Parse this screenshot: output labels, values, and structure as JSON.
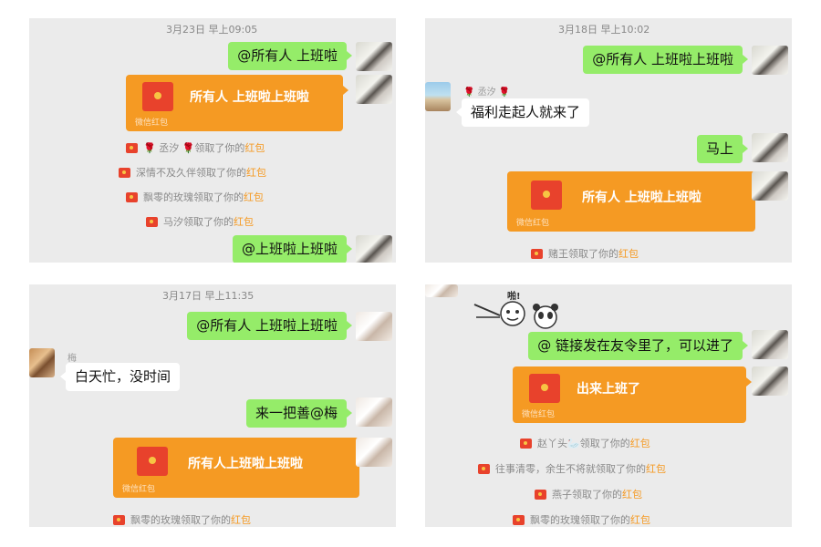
{
  "panel1": {
    "timestamp": "3月23日 早上09:05",
    "msg1": "@所有人  上班啦",
    "hongbao_text": "所有人 上班啦上班啦",
    "hongbao_foot": "微信红包",
    "receipts": [
      {
        "name": "🌹 丞汐 🌹 ",
        "action": "领取了你的",
        "hl": "红包"
      },
      {
        "name": "深情不及久伴",
        "action": "领取了你的",
        "hl": "红包"
      },
      {
        "name": "飘零的玫瑰",
        "action": "领取了你的",
        "hl": "红包"
      },
      {
        "name": "马汐",
        "action": "领取了你的",
        "hl": "红包"
      }
    ],
    "msg2": "@上班啦上班啦"
  },
  "panel2": {
    "timestamp": "3月18日 早上10:02",
    "msg1": "@所有人  上班啦上班啦",
    "nick": "🌹 丞汐 🌹",
    "incoming": "福利走起人就来了",
    "msg2": "马上",
    "hongbao_text": "所有人  上班啦上班啦",
    "hongbao_foot": "微信红包",
    "receipt": {
      "name": "赌王",
      "action": "领取了你的",
      "hl": "红包"
    }
  },
  "panel3": {
    "timestamp": "3月17日 早上11:35",
    "msg1": "@所有人  上班啦上班啦",
    "nick": "梅",
    "incoming": "白天忙，没时间",
    "msg2": "来一把善@梅",
    "hongbao_text": "所有人上班啦上班啦",
    "hongbao_foot": "微信红包",
    "receipt": {
      "name": "飘零的玫瑰",
      "action": "领取了你的",
      "hl": "红包"
    }
  },
  "panel4": {
    "sticker_text": "啪!",
    "msg1": "@  链接发在友令里了，可以进了",
    "hongbao_text": "出来上班了",
    "hongbao_foot": "微信红包",
    "receipts": [
      {
        "name": "赵丫头🦢",
        "action": "领取了你的",
        "hl": "红包"
      },
      {
        "name": "往事清零，余生不将就",
        "action": "领取了你的",
        "hl": "红包"
      },
      {
        "name": "燕子",
        "action": "领取了你的",
        "hl": "红包"
      },
      {
        "name": "飘零的玫瑰",
        "action": "领取了你的",
        "hl": "红包"
      }
    ]
  },
  "colors": {
    "bubble_green": "#95ec69",
    "hongbao": "#f59a23",
    "panel_bg": "#ebebeb",
    "highlight": "#f59a23"
  }
}
